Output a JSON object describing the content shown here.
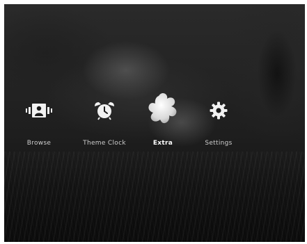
{
  "menu": {
    "items": [
      {
        "label": "Browse",
        "icon": "browse-icon",
        "selected": false
      },
      {
        "label": "Theme Clock",
        "icon": "alarm-clock-icon",
        "selected": false
      },
      {
        "label": "Extra",
        "icon": "flower-icon",
        "selected": true
      },
      {
        "label": "Settings",
        "icon": "gear-icon",
        "selected": false
      }
    ]
  },
  "colors": {
    "label": "#cfcfcf",
    "selected_label": "#ffffff",
    "icon": "#f2f2f2",
    "background": "#0f0f0f"
  }
}
